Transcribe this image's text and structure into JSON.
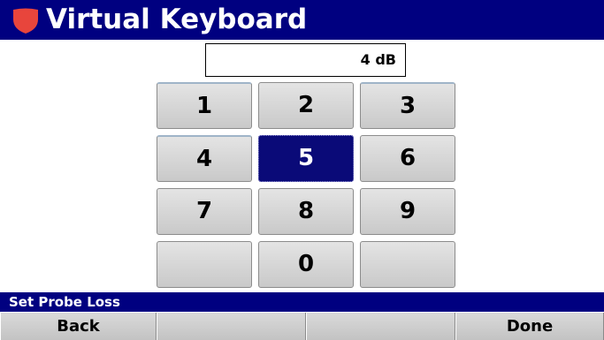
{
  "title": "Virtual Keyboard",
  "title_icon": "shield-icon",
  "colors": {
    "title_bar": "#000080",
    "icon": "#e8453c",
    "selected_key": "#0a0a78",
    "key_face": "#d8d8d8"
  },
  "value_field": {
    "value": "4 dB"
  },
  "keypad": {
    "selected": "5",
    "keys": [
      "1",
      "2",
      "3",
      "4",
      "5",
      "6",
      "7",
      "8",
      "9",
      "",
      "0",
      ""
    ]
  },
  "prompt": "Set Probe Loss",
  "softkeys": [
    "Back",
    "",
    "",
    "Done"
  ]
}
